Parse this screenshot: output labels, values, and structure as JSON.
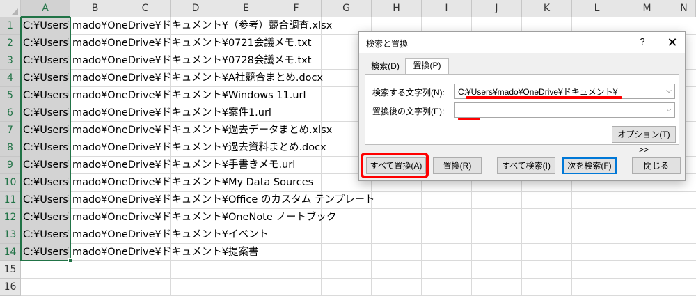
{
  "spreadsheet": {
    "columns": [
      "A",
      "B",
      "C",
      "D",
      "E",
      "F",
      "G",
      "H",
      "I",
      "J",
      "K",
      "L",
      "M",
      "N"
    ],
    "rows": [
      "1",
      "2",
      "3",
      "4",
      "5",
      "6",
      "7",
      "8",
      "9",
      "10",
      "11",
      "12",
      "13",
      "14",
      "15",
      "16"
    ],
    "cells": [
      {
        "a": "C:¥Users¥",
        "rest": "mado¥OneDrive¥ドキュメント¥（参考）競合調査.xlsx"
      },
      {
        "a": "C:¥Users¥",
        "rest": "mado¥OneDrive¥ドキュメント¥0721会議メモ.txt"
      },
      {
        "a": "C:¥Users¥",
        "rest": "mado¥OneDrive¥ドキュメント¥0728会議メモ.txt"
      },
      {
        "a": "C:¥Users¥",
        "rest": "mado¥OneDrive¥ドキュメント¥A社競合まとめ.docx"
      },
      {
        "a": "C:¥Users¥",
        "rest": "mado¥OneDrive¥ドキュメント¥Windows 11.url"
      },
      {
        "a": "C:¥Users¥",
        "rest": "mado¥OneDrive¥ドキュメント¥案件1.url"
      },
      {
        "a": "C:¥Users¥",
        "rest": "mado¥OneDrive¥ドキュメント¥過去データまとめ.xlsx"
      },
      {
        "a": "C:¥Users¥",
        "rest": "mado¥OneDrive¥ドキュメント¥過去資料まとめ.docx"
      },
      {
        "a": "C:¥Users¥",
        "rest": "mado¥OneDrive¥ドキュメント¥手書きメモ.url"
      },
      {
        "a": "C:¥Users¥",
        "rest": "mado¥OneDrive¥ドキュメント¥My Data Sources"
      },
      {
        "a": "C:¥Users¥",
        "rest": "mado¥OneDrive¥ドキュメント¥Office のカスタム テンプレート"
      },
      {
        "a": "C:¥Users¥",
        "rest": "mado¥OneDrive¥ドキュメント¥OneNote ノートブック"
      },
      {
        "a": "C:¥Users¥",
        "rest": "mado¥OneDrive¥ドキュメント¥イベント"
      },
      {
        "a": "C:¥Users¥",
        "rest": "mado¥OneDrive¥ドキュメント¥提案書"
      }
    ]
  },
  "dialog": {
    "title": "検索と置換",
    "help": "?",
    "close": "✕",
    "tabs": {
      "search": "検索(D)",
      "replace": "置換(P)"
    },
    "find_label": "検索する文字列(N):",
    "find_value": "C:¥Users¥mado¥OneDrive¥ドキュメント¥",
    "replace_label": "置換後の文字列(E):",
    "replace_value": "",
    "options_button": "オプション(T) >>",
    "buttons": {
      "replace_all": "すべて置換(A)",
      "replace": "置換(R)",
      "find_all": "すべて検索(I)",
      "find_next": "次を検索(F)",
      "close": "閉じる"
    },
    "dropdown_arrow": "⌵"
  },
  "colors": {
    "accent_green": "#217346",
    "highlight_red": "#ff0000",
    "default_button_blue": "#0078d7"
  }
}
